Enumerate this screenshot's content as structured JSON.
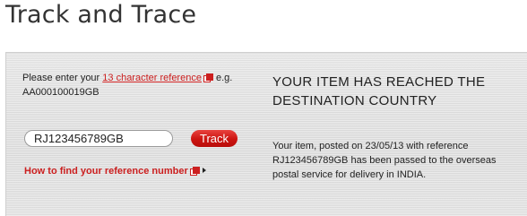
{
  "page": {
    "title": "Track and Trace"
  },
  "form": {
    "prompt_before": "Please enter your ",
    "prompt_link": "13 character reference",
    "prompt_after": " e.g. AA000100019GB",
    "input_value": "RJ123456789GB",
    "track_label": "Track",
    "howto_label": "How to find your reference number"
  },
  "result": {
    "heading": "YOUR ITEM HAS REACHED THE DESTINATION COUNTRY",
    "message": "Your item, posted on 23/05/13 with reference RJ123456789GB has been passed to the overseas postal service for delivery in INDIA."
  },
  "colors": {
    "accent": "#cc1f1f",
    "panel_bg": "#e5e5e5",
    "text": "#222222"
  },
  "icons": {
    "external_link": "external-link-icon",
    "arrow": "arrow-right-icon"
  }
}
